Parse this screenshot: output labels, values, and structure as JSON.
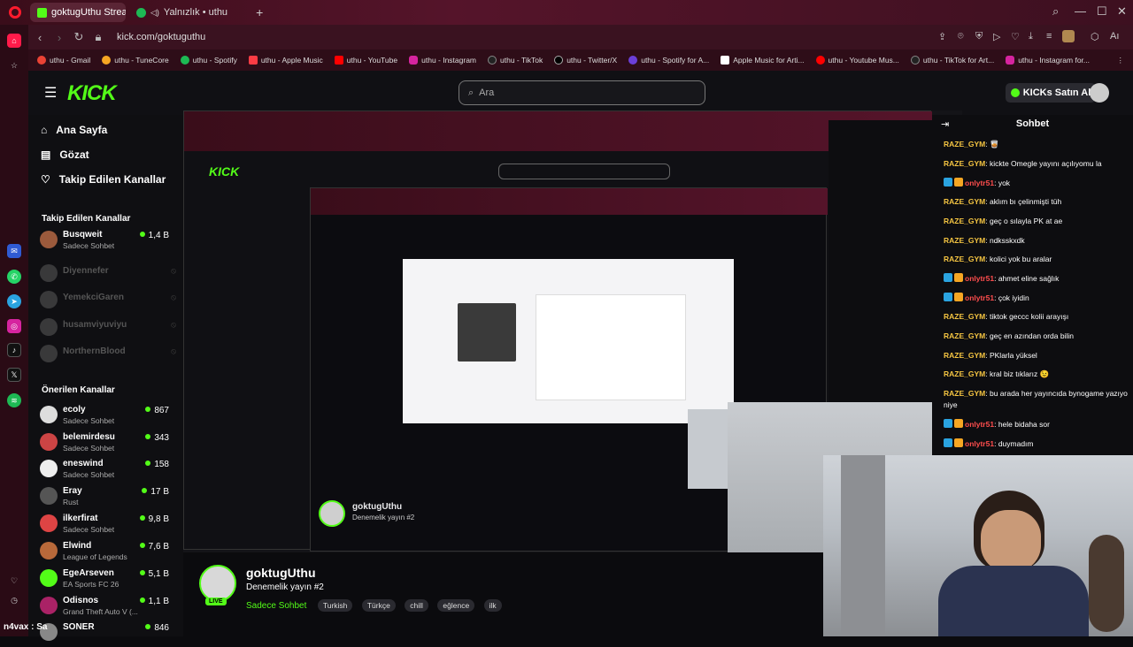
{
  "browser": {
    "tabs": [
      {
        "label": "goktugUthu Stream - Wa"
      },
      {
        "label": "Yalnızlık • uthu"
      }
    ],
    "url": "kick.com/goktuguthu",
    "bookmarks": [
      "uthu - Gmail",
      "uthu - TuneCore",
      "uthu - Spotify",
      "uthu - Apple Music",
      "uthu - YouTube",
      "uthu - Instagram",
      "uthu - TikTok",
      "uthu - Twitter/X",
      "uthu - Spotify for A...",
      "Apple Music for Arti...",
      "uthu - Youtube Mus...",
      "uthu - TikTok for Art...",
      "uthu - Instagram for..."
    ]
  },
  "kick": {
    "logo": "KICK",
    "search_placeholder": "Ara",
    "kicks_button": "KICKs Satın Al",
    "nav": {
      "home": "Ana Sayfa",
      "browse": "Gözat",
      "following": "Takip Edilen Kanallar"
    },
    "followed_title": "Takip Edilen Kanallar",
    "followed": [
      {
        "name": "Busqweit",
        "category": "Sadece Sohbet",
        "viewers": "1,4 B",
        "online": true
      },
      {
        "name": "Diyennefer",
        "online": false
      },
      {
        "name": "YemekciGaren",
        "online": false
      },
      {
        "name": "husamviyuviyu",
        "online": false
      },
      {
        "name": "NorthernBlood",
        "online": false
      }
    ],
    "recommended_title": "Önerilen Kanallar",
    "recommended": [
      {
        "name": "ecoly",
        "category": "Sadece Sohbet",
        "viewers": "867"
      },
      {
        "name": "belemirdesu",
        "category": "Sadece Sohbet",
        "viewers": "343"
      },
      {
        "name": "eneswind",
        "category": "Sadece Sohbet",
        "viewers": "158"
      },
      {
        "name": "Eray",
        "category": "Rust",
        "viewers": "17 B"
      },
      {
        "name": "ilkerfirat",
        "category": "Sadece Sohbet",
        "viewers": "9,8 B"
      },
      {
        "name": "Elwind",
        "category": "League of Legends",
        "viewers": "7,6 B"
      },
      {
        "name": "EgeArseven",
        "category": "EA Sports FC 26",
        "viewers": "5,1 B"
      },
      {
        "name": "Odisnos",
        "category": "Grand Theft Auto V (...",
        "viewers": "1,1 B"
      },
      {
        "name": "SONER",
        "category": "",
        "viewers": "846"
      }
    ],
    "stream": {
      "channel": "goktugUthu",
      "title": "Denemelik yayın #2",
      "category": "Sadece Sohbet",
      "tags": [
        "Turkish",
        "Türkçe",
        "chill",
        "eğlence",
        "ilk"
      ],
      "live": "LIVE"
    },
    "chat_title": "Sohbet",
    "chat": [
      {
        "user": "RAZE_GYM",
        "text": "🥃",
        "type": "u1"
      },
      {
        "user": "RAZE_GYM",
        "text": "kickte Omegle yayını açılıyomu la",
        "type": "u1"
      },
      {
        "user": "onlytr51",
        "text": "yok",
        "type": "u2"
      },
      {
        "user": "RAZE_GYM",
        "text": "aklım bı çelinmişti tüh",
        "type": "u1"
      },
      {
        "user": "RAZE_GYM",
        "text": "geç o sılayla PK at ae",
        "type": "u1"
      },
      {
        "user": "RAZE_GYM",
        "text": "ndksskxdk",
        "type": "u1"
      },
      {
        "user": "RAZE_GYM",
        "text": "kolici yok bu aralar",
        "type": "u1"
      },
      {
        "user": "onlytr51",
        "text": "ahmet eline sağlık",
        "type": "u2"
      },
      {
        "user": "onlytr51",
        "text": "çok iyidin",
        "type": "u2"
      },
      {
        "user": "RAZE_GYM",
        "text": "tiktok geccc kolii arayışı",
        "type": "u1"
      },
      {
        "user": "RAZE_GYM",
        "text": "geç en azından orda bilin",
        "type": "u1"
      },
      {
        "user": "RAZE_GYM",
        "text": "PKlarla yüksel",
        "type": "u1"
      },
      {
        "user": "RAZE_GYM",
        "text": "kral biz tıklarız 😉",
        "type": "u1"
      },
      {
        "user": "RAZE_GYM",
        "text": "bu arada her yayıncıda bynogame yazıyo niye",
        "type": "u1"
      },
      {
        "user": "onlytr51",
        "text": "hele bidaha sor",
        "type": "u2"
      },
      {
        "user": "onlytr51",
        "text": "duymadım",
        "type": "u2"
      }
    ],
    "overlay_text": "n4vax : Sa"
  }
}
